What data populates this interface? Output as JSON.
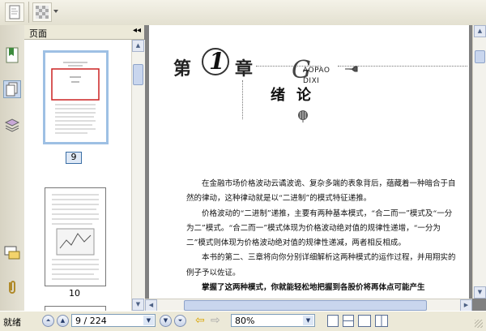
{
  "toolbar": {
    "buttons": [
      "page-thumbnail-icon",
      "checker-icon",
      "dropdown-arrow-icon"
    ]
  },
  "rail": {
    "icons": [
      "bookmark-icon",
      "pages-icon",
      "layers-icon",
      "comments-icon",
      "attachment-icon"
    ]
  },
  "pages_panel": {
    "title": "页面",
    "collapse_glyph": "◂◂",
    "thumbnails": [
      {
        "label": "9",
        "selected": true
      },
      {
        "label": "10",
        "selected": false
      }
    ]
  },
  "document": {
    "chapter_prefix": "第",
    "chapter_number": "1",
    "chapter_suffix": "章",
    "logo_letter": "G",
    "logo_line1": "AOPAO",
    "logo_line2": "DIXI",
    "chapter_title": "绪论",
    "paragraphs": [
      "在金融市场价格波动云谲波诡、复杂多端的表象背后，蕴藏着一种暗合于自然的律动，这种律动就是以“二进制”的模式特征递推。",
      "价格波动的“二进制”递推，主要有两种基本模式，“合二而一”模式及“一分为二”模式。“合二而一”模式体现为价格波动绝对值的规律性递增，“一分为二”模式则体现为价格波动绝对值的规律性递减，两者相反相成。",
      "本书的第二、三章将向你分别详细解析这两种模式的运作过程，并用翔实的例子予以佐证。",
      "掌握了这两种模式，你就能轻松地把握到各股价将再体点可能产生"
    ]
  },
  "statusbar": {
    "status": "就绪",
    "page_value": "9 / 224",
    "zoom_value": "80%",
    "nav_glyphs": {
      "first": "⏶",
      "prev": "▲",
      "next": "▼",
      "last": "⏷",
      "back": "⇦",
      "forward": "⇨"
    }
  },
  "colors": {
    "accent": "#3a6ea5",
    "selection": "#9ec0e4",
    "viewer_bg": "#808080",
    "red_box": "#cc2222"
  }
}
